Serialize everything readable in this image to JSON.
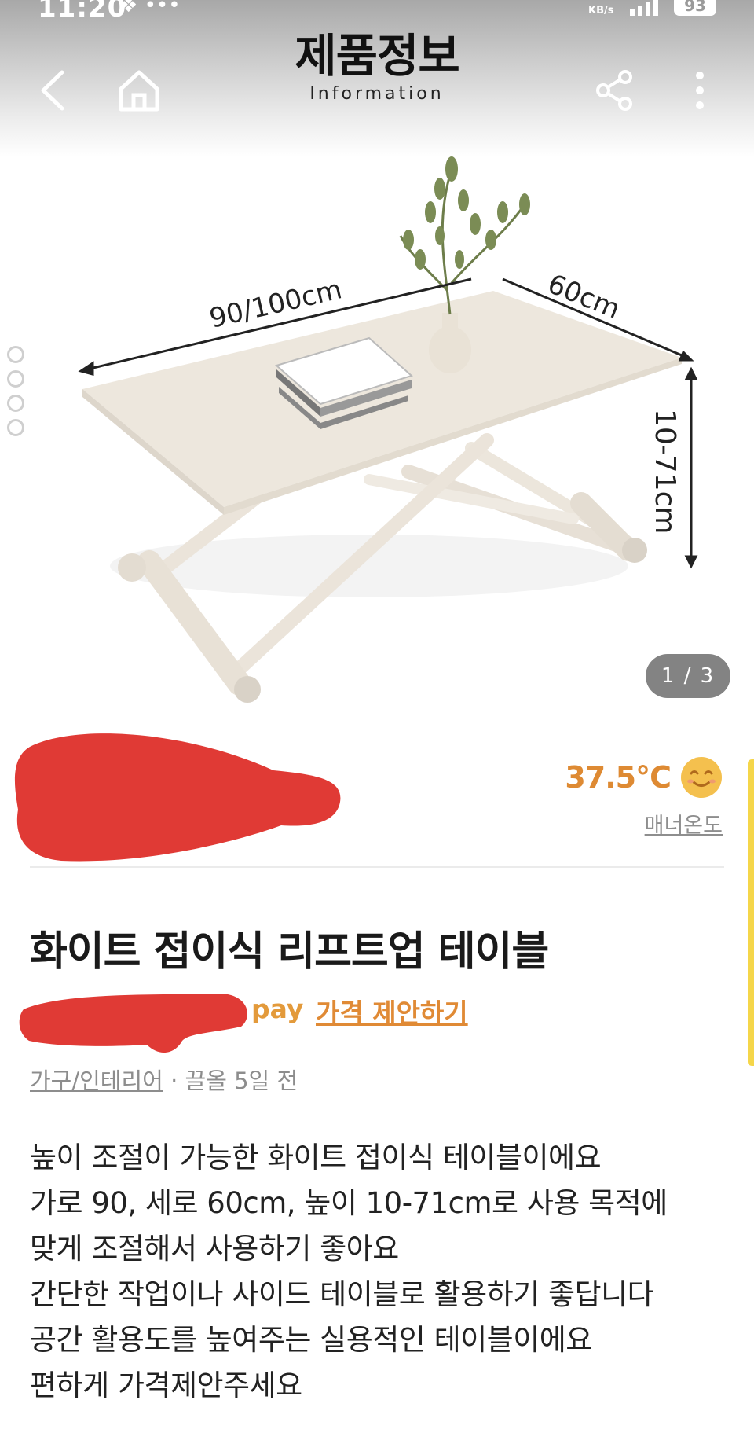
{
  "status_bar": {
    "time": "11:20",
    "extra_icons": "❖ •••",
    "network_unit": "KB/s",
    "battery": "93"
  },
  "header": {
    "title": "제품정보",
    "subtitle": "Information"
  },
  "product_image": {
    "dimension_width": "90/100cm",
    "dimension_depth": "60cm",
    "dimension_height": "10-71cm",
    "counter": "1 / 3"
  },
  "seller": {
    "manner_temperature": "37.5°C",
    "manner_label": "매너온도"
  },
  "product": {
    "title": "화이트 접이식 리프트업 테이블",
    "pay_label": "pay",
    "offer_label": "가격 제안하기",
    "category": "가구/인테리어",
    "posted": "· 끌올 5일 전",
    "description": [
      "높이 조절이 가능한 화이트 접이식 테이블이에요",
      "가로 90, 세로 60cm, 높이 10-71cm로 사용 목적에",
      "맞게 조절해서 사용하기 좋아요",
      "간단한 작업이나 사이드 테이블로 활용하기 좋답니다",
      "공간 활용도를 높여주는 실용적인 테이블이에요",
      "편하게 가격제안주세요"
    ]
  },
  "colors": {
    "accent": "#de8a33",
    "redaction": "#e03a35",
    "counter_bg": "#646464",
    "edge_tab": "#f5d64a"
  },
  "icons": [
    "back-icon",
    "home-icon",
    "share-icon",
    "more-icon",
    "smiley-icon"
  ]
}
